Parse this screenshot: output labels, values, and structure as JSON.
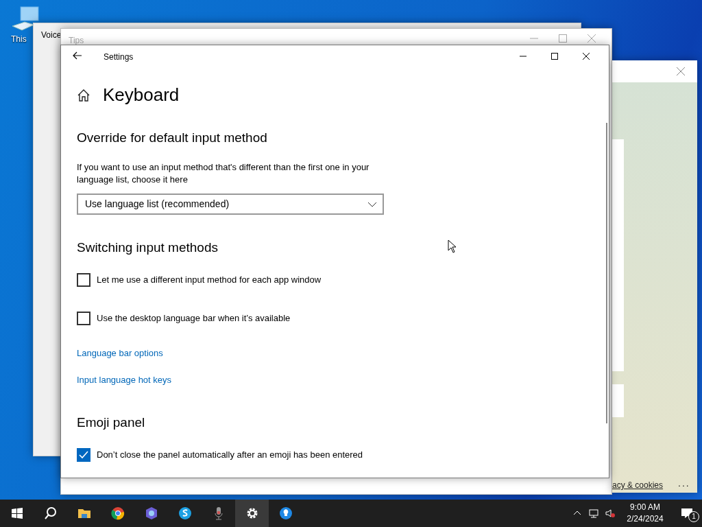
{
  "desktop_icons": [
    {
      "label": "This"
    }
  ],
  "back_windows": [
    {
      "title": "Voice"
    },
    {
      "title": "Tips"
    }
  ],
  "browser_window": {
    "footer_link": "acy & cookies",
    "more_button": "..."
  },
  "settings": {
    "title": "Settings",
    "page_title": "Keyboard",
    "sections": [
      {
        "heading": "Override for default input method",
        "items": [
          {
            "kind": "description",
            "text": "If you want to use an input method that's different than the first one in your language list, choose it here"
          },
          {
            "kind": "dropdown",
            "value": "Use language list (recommended)"
          }
        ]
      },
      {
        "heading": "Switching input methods",
        "items": [
          {
            "kind": "checkbox",
            "label": "Let me use a different input method for each app window",
            "checked": false
          },
          {
            "kind": "checkbox",
            "label": "Use the desktop language bar when it’s available",
            "checked": false
          },
          {
            "kind": "link",
            "text": "Language bar options"
          },
          {
            "kind": "link",
            "text": "Input language hot keys"
          }
        ]
      },
      {
        "heading": "Emoji panel",
        "items": [
          {
            "kind": "checkbox",
            "label": "Don’t close the panel automatically after an emoji has been entered",
            "checked": true
          }
        ]
      }
    ]
  },
  "taskbar": {
    "apps": [
      {
        "kind": "start",
        "selected": false
      },
      {
        "kind": "search",
        "selected": false
      },
      {
        "kind": "folder",
        "selected": false
      },
      {
        "kind": "chrome",
        "selected": false
      },
      {
        "kind": "copilot",
        "selected": false
      },
      {
        "kind": "skype",
        "selected": false
      },
      {
        "kind": "mic",
        "selected": false
      },
      {
        "kind": "settings",
        "selected": true
      },
      {
        "kind": "tips",
        "selected": false
      }
    ],
    "time": "9:00 AM",
    "date": "2/24/2024",
    "notification_count": "1"
  }
}
